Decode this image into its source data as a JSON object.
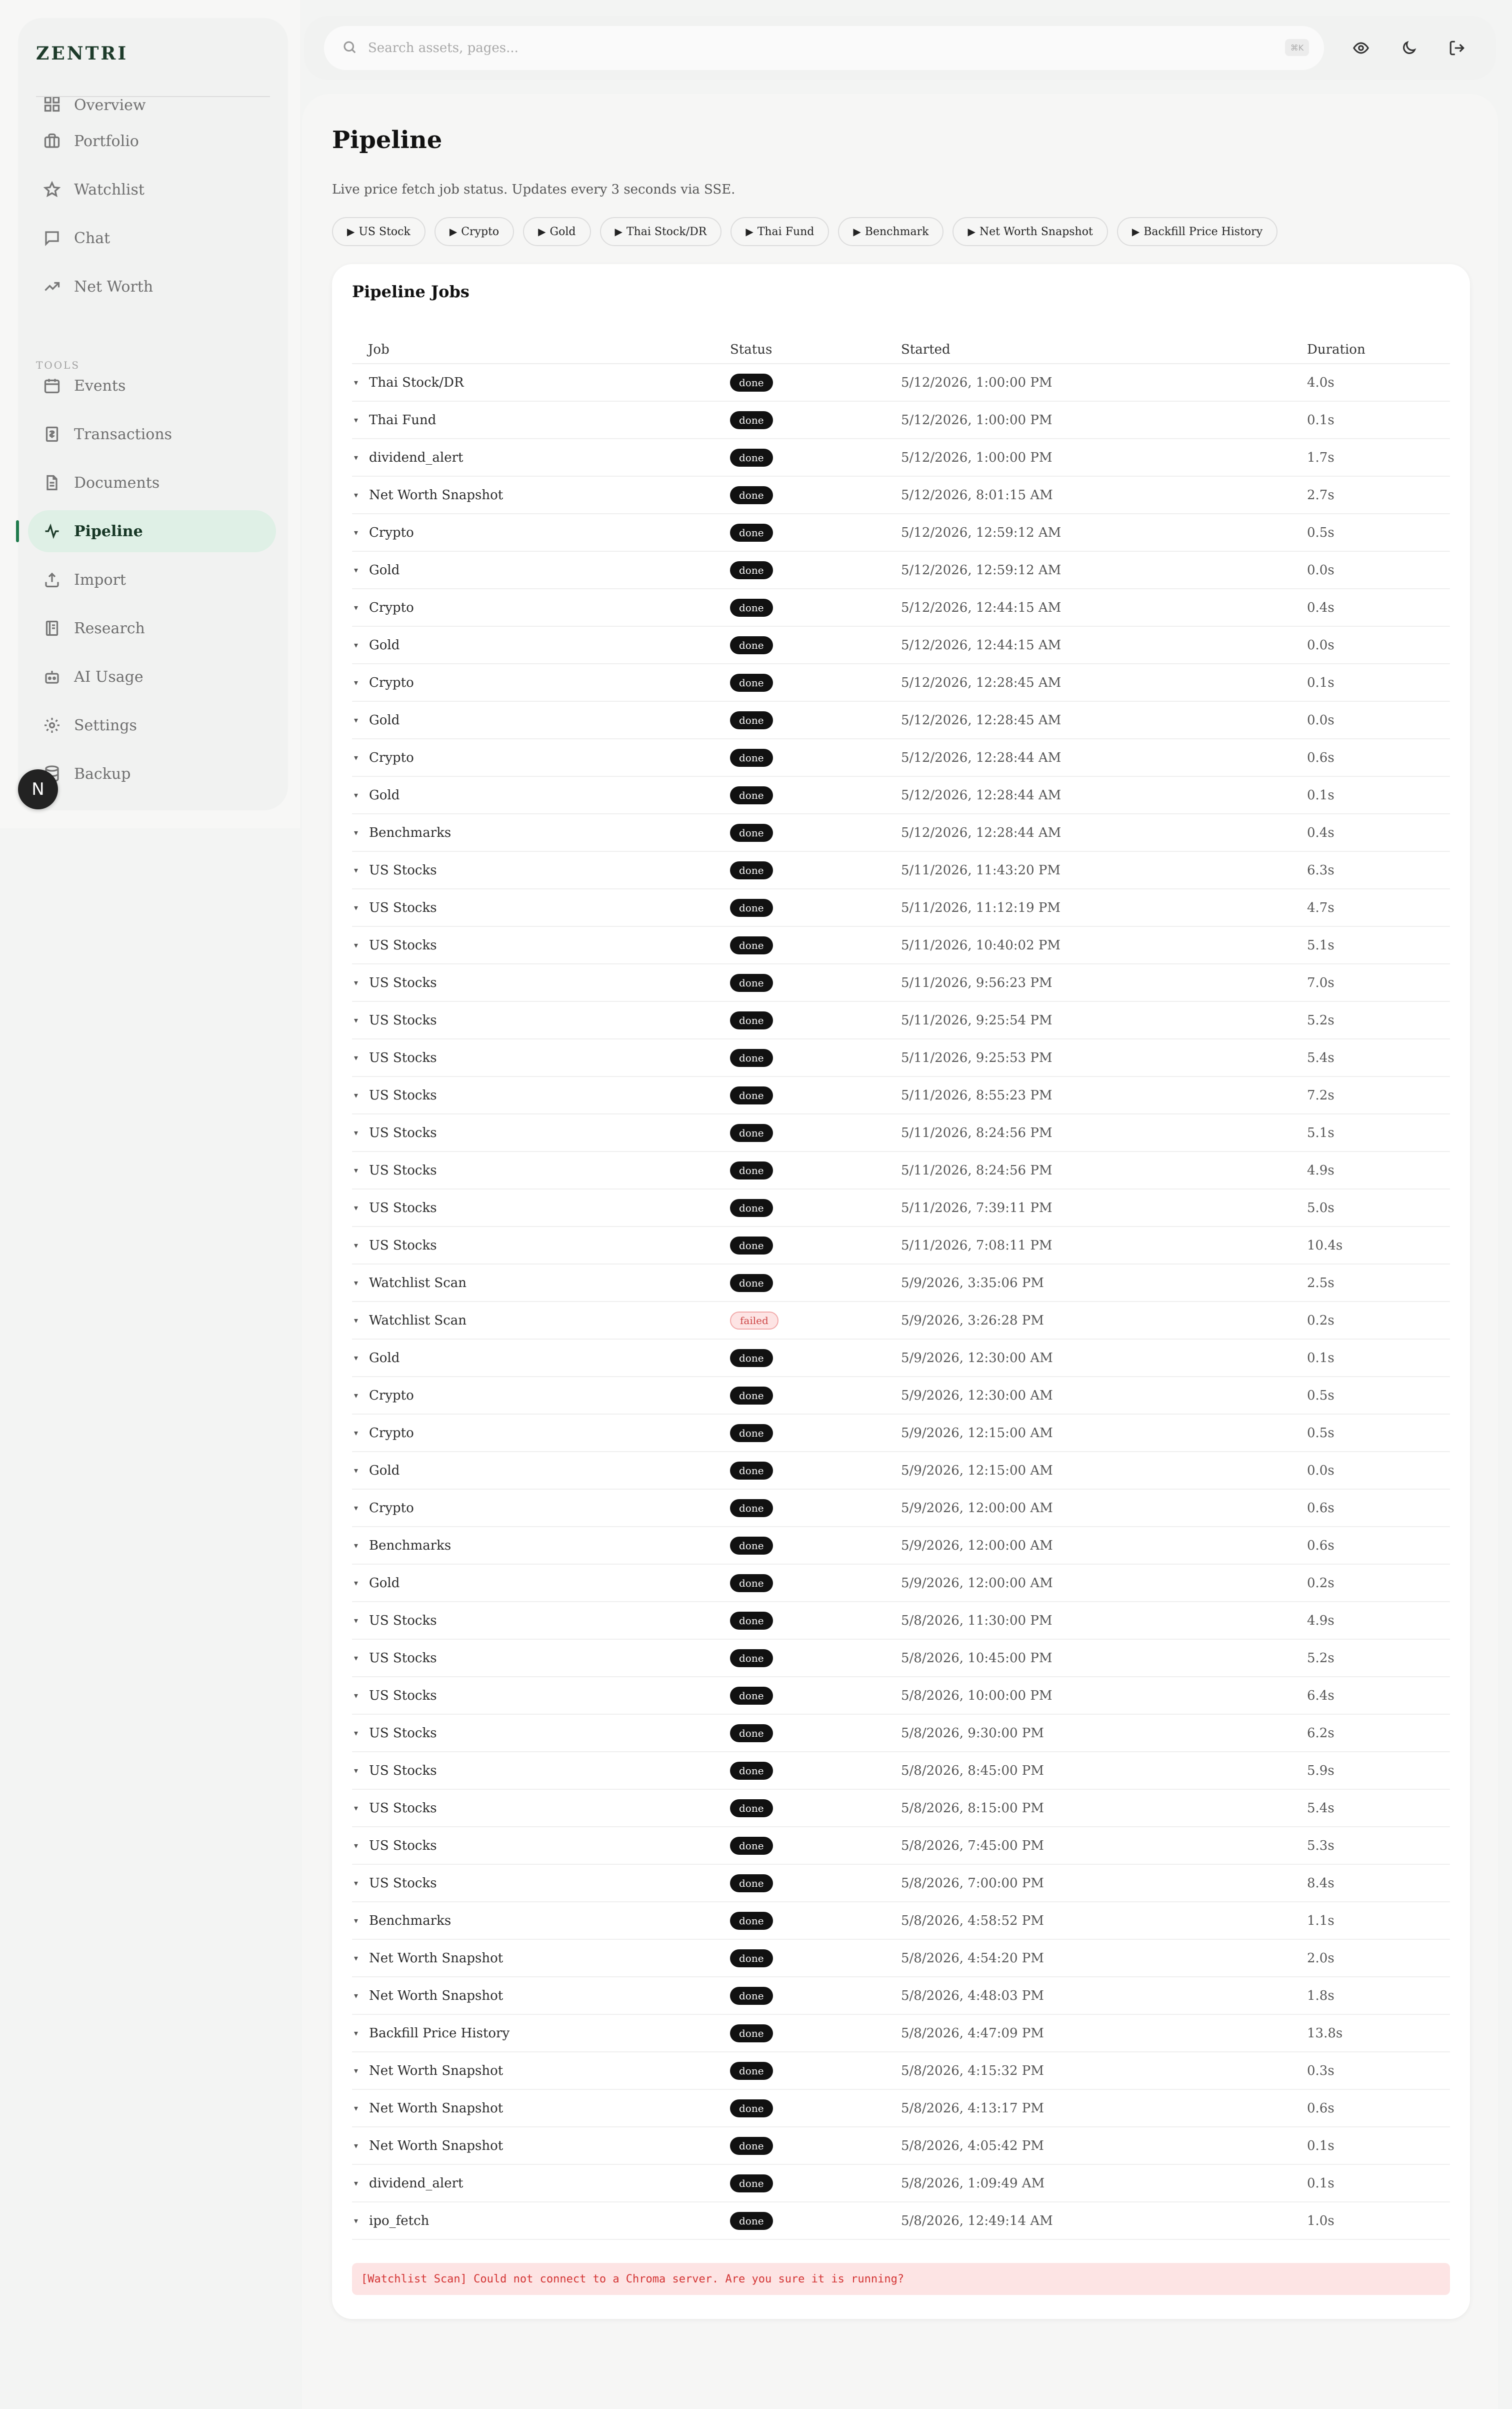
{
  "brand": "ZENTRI",
  "sidebar": {
    "clipped_item": "Overview",
    "items": [
      {
        "label": "Portfolio",
        "icon": "briefcase-icon"
      },
      {
        "label": "Watchlist",
        "icon": "star-icon"
      },
      {
        "label": "Chat",
        "icon": "chat-icon"
      },
      {
        "label": "Net Worth",
        "icon": "trending-up-icon"
      }
    ],
    "tools_label": "TOOLS",
    "tools": [
      {
        "label": "Events",
        "icon": "calendar-icon"
      },
      {
        "label": "Transactions",
        "icon": "receipt-icon"
      },
      {
        "label": "Documents",
        "icon": "document-icon"
      },
      {
        "label": "Pipeline",
        "icon": "activity-icon",
        "active": true
      },
      {
        "label": "Import",
        "icon": "upload-icon"
      },
      {
        "label": "Research",
        "icon": "notebook-icon"
      },
      {
        "label": "AI Usage",
        "icon": "bot-icon"
      },
      {
        "label": "Settings",
        "icon": "gear-icon"
      },
      {
        "label": "Backup",
        "icon": "database-icon"
      }
    ],
    "badge": "N"
  },
  "search": {
    "placeholder": "Search assets, pages...",
    "value": "",
    "shortcut": "⌘K"
  },
  "page": {
    "title": "Pipeline",
    "subtitle": "Live price fetch job status. Updates every 3 seconds via SSE."
  },
  "actions": [
    "US Stock",
    "Crypto",
    "Gold",
    "Thai Stock/DR",
    "Thai Fund",
    "Benchmark",
    "Net Worth Snapshot",
    "Backfill Price History"
  ],
  "jobs": {
    "title": "Pipeline Jobs",
    "columns": {
      "job": "Job",
      "status": "Status",
      "started": "Started",
      "duration": "Duration"
    },
    "rows": [
      {
        "job": "Thai Stock/DR",
        "status": "done",
        "started": "5/12/2026, 1:00:00 PM",
        "duration": "4.0s"
      },
      {
        "job": "Thai Fund",
        "status": "done",
        "started": "5/12/2026, 1:00:00 PM",
        "duration": "0.1s"
      },
      {
        "job": "dividend_alert",
        "status": "done",
        "started": "5/12/2026, 1:00:00 PM",
        "duration": "1.7s"
      },
      {
        "job": "Net Worth Snapshot",
        "status": "done",
        "started": "5/12/2026, 8:01:15 AM",
        "duration": "2.7s"
      },
      {
        "job": "Crypto",
        "status": "done",
        "started": "5/12/2026, 12:59:12 AM",
        "duration": "0.5s"
      },
      {
        "job": "Gold",
        "status": "done",
        "started": "5/12/2026, 12:59:12 AM",
        "duration": "0.0s"
      },
      {
        "job": "Crypto",
        "status": "done",
        "started": "5/12/2026, 12:44:15 AM",
        "duration": "0.4s"
      },
      {
        "job": "Gold",
        "status": "done",
        "started": "5/12/2026, 12:44:15 AM",
        "duration": "0.0s"
      },
      {
        "job": "Crypto",
        "status": "done",
        "started": "5/12/2026, 12:28:45 AM",
        "duration": "0.1s"
      },
      {
        "job": "Gold",
        "status": "done",
        "started": "5/12/2026, 12:28:45 AM",
        "duration": "0.0s"
      },
      {
        "job": "Crypto",
        "status": "done",
        "started": "5/12/2026, 12:28:44 AM",
        "duration": "0.6s"
      },
      {
        "job": "Gold",
        "status": "done",
        "started": "5/12/2026, 12:28:44 AM",
        "duration": "0.1s"
      },
      {
        "job": "Benchmarks",
        "status": "done",
        "started": "5/12/2026, 12:28:44 AM",
        "duration": "0.4s"
      },
      {
        "job": "US Stocks",
        "status": "done",
        "started": "5/11/2026, 11:43:20 PM",
        "duration": "6.3s"
      },
      {
        "job": "US Stocks",
        "status": "done",
        "started": "5/11/2026, 11:12:19 PM",
        "duration": "4.7s"
      },
      {
        "job": "US Stocks",
        "status": "done",
        "started": "5/11/2026, 10:40:02 PM",
        "duration": "5.1s"
      },
      {
        "job": "US Stocks",
        "status": "done",
        "started": "5/11/2026, 9:56:23 PM",
        "duration": "7.0s"
      },
      {
        "job": "US Stocks",
        "status": "done",
        "started": "5/11/2026, 9:25:54 PM",
        "duration": "5.2s"
      },
      {
        "job": "US Stocks",
        "status": "done",
        "started": "5/11/2026, 9:25:53 PM",
        "duration": "5.4s"
      },
      {
        "job": "US Stocks",
        "status": "done",
        "started": "5/11/2026, 8:55:23 PM",
        "duration": "7.2s"
      },
      {
        "job": "US Stocks",
        "status": "done",
        "started": "5/11/2026, 8:24:56 PM",
        "duration": "5.1s"
      },
      {
        "job": "US Stocks",
        "status": "done",
        "started": "5/11/2026, 8:24:56 PM",
        "duration": "4.9s"
      },
      {
        "job": "US Stocks",
        "status": "done",
        "started": "5/11/2026, 7:39:11 PM",
        "duration": "5.0s"
      },
      {
        "job": "US Stocks",
        "status": "done",
        "started": "5/11/2026, 7:08:11 PM",
        "duration": "10.4s"
      },
      {
        "job": "Watchlist Scan",
        "status": "done",
        "started": "5/9/2026, 3:35:06 PM",
        "duration": "2.5s"
      },
      {
        "job": "Watchlist Scan",
        "status": "failed",
        "started": "5/9/2026, 3:26:28 PM",
        "duration": "0.2s"
      },
      {
        "job": "Gold",
        "status": "done",
        "started": "5/9/2026, 12:30:00 AM",
        "duration": "0.1s"
      },
      {
        "job": "Crypto",
        "status": "done",
        "started": "5/9/2026, 12:30:00 AM",
        "duration": "0.5s"
      },
      {
        "job": "Crypto",
        "status": "done",
        "started": "5/9/2026, 12:15:00 AM",
        "duration": "0.5s"
      },
      {
        "job": "Gold",
        "status": "done",
        "started": "5/9/2026, 12:15:00 AM",
        "duration": "0.0s"
      },
      {
        "job": "Crypto",
        "status": "done",
        "started": "5/9/2026, 12:00:00 AM",
        "duration": "0.6s"
      },
      {
        "job": "Benchmarks",
        "status": "done",
        "started": "5/9/2026, 12:00:00 AM",
        "duration": "0.6s"
      },
      {
        "job": "Gold",
        "status": "done",
        "started": "5/9/2026, 12:00:00 AM",
        "duration": "0.2s"
      },
      {
        "job": "US Stocks",
        "status": "done",
        "started": "5/8/2026, 11:30:00 PM",
        "duration": "4.9s"
      },
      {
        "job": "US Stocks",
        "status": "done",
        "started": "5/8/2026, 10:45:00 PM",
        "duration": "5.2s"
      },
      {
        "job": "US Stocks",
        "status": "done",
        "started": "5/8/2026, 10:00:00 PM",
        "duration": "6.4s"
      },
      {
        "job": "US Stocks",
        "status": "done",
        "started": "5/8/2026, 9:30:00 PM",
        "duration": "6.2s"
      },
      {
        "job": "US Stocks",
        "status": "done",
        "started": "5/8/2026, 8:45:00 PM",
        "duration": "5.9s"
      },
      {
        "job": "US Stocks",
        "status": "done",
        "started": "5/8/2026, 8:15:00 PM",
        "duration": "5.4s"
      },
      {
        "job": "US Stocks",
        "status": "done",
        "started": "5/8/2026, 7:45:00 PM",
        "duration": "5.3s"
      },
      {
        "job": "US Stocks",
        "status": "done",
        "started": "5/8/2026, 7:00:00 PM",
        "duration": "8.4s"
      },
      {
        "job": "Benchmarks",
        "status": "done",
        "started": "5/8/2026, 4:58:52 PM",
        "duration": "1.1s"
      },
      {
        "job": "Net Worth Snapshot",
        "status": "done",
        "started": "5/8/2026, 4:54:20 PM",
        "duration": "2.0s"
      },
      {
        "job": "Net Worth Snapshot",
        "status": "done",
        "started": "5/8/2026, 4:48:03 PM",
        "duration": "1.8s"
      },
      {
        "job": "Backfill Price History",
        "status": "done",
        "started": "5/8/2026, 4:47:09 PM",
        "duration": "13.8s"
      },
      {
        "job": "Net Worth Snapshot",
        "status": "done",
        "started": "5/8/2026, 4:15:32 PM",
        "duration": "0.3s"
      },
      {
        "job": "Net Worth Snapshot",
        "status": "done",
        "started": "5/8/2026, 4:13:17 PM",
        "duration": "0.6s"
      },
      {
        "job": "Net Worth Snapshot",
        "status": "done",
        "started": "5/8/2026, 4:05:42 PM",
        "duration": "0.1s"
      },
      {
        "job": "dividend_alert",
        "status": "done",
        "started": "5/8/2026, 1:09:49 AM",
        "duration": "0.1s"
      },
      {
        "job": "ipo_fetch",
        "status": "done",
        "started": "5/8/2026, 12:49:14 AM",
        "duration": "1.0s"
      }
    ],
    "error": "[Watchlist Scan] Could not connect to a Chroma server. Are you sure it is running?"
  },
  "colors": {
    "accent": "#1f7a4c",
    "active_bg": "#dff0e6",
    "done_badge": "#111111",
    "failed_badge": "#fde4e4",
    "error_text": "#d33333"
  }
}
